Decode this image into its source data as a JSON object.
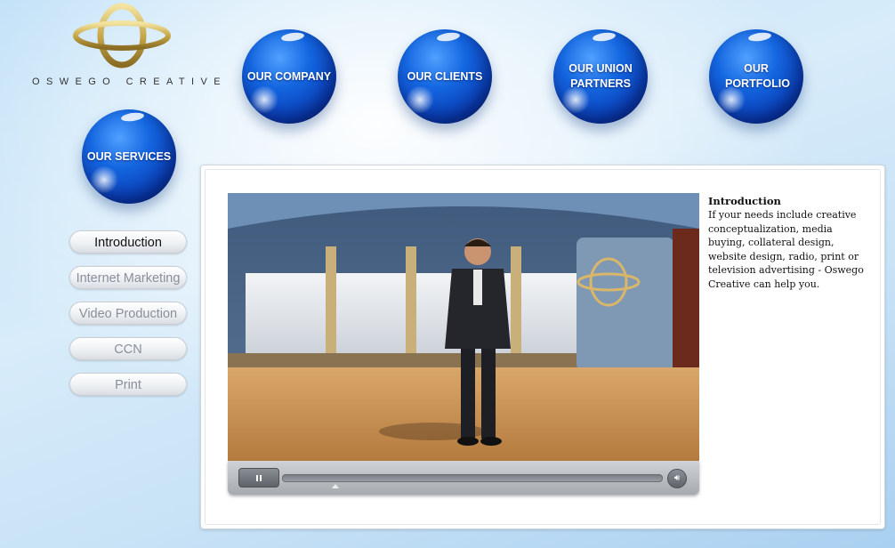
{
  "brand": {
    "name": "OSWEGO CREATIVE",
    "logo_icon": "oc-ring-logo"
  },
  "top_nav": [
    {
      "label": "OUR COMPANY"
    },
    {
      "label": "OUR CLIENTS"
    },
    {
      "label": "OUR UNION PARTNERS"
    },
    {
      "label": "OUR PORTFOLIO"
    }
  ],
  "section_orb": {
    "label": "OUR SERVICES"
  },
  "side_nav": [
    {
      "label": "Introduction",
      "active": true
    },
    {
      "label": "Internet Marketing"
    },
    {
      "label": "Video Production"
    },
    {
      "label": "CCN"
    },
    {
      "label": "Print"
    }
  ],
  "video": {
    "icons": {
      "pause": "pause-icon",
      "volume": "volume-icon"
    },
    "progress": 0.14
  },
  "content": {
    "title": "Introduction",
    "body": "If your needs include creative conceptualization, media buying,  collateral design, website design, radio, print or television advertising - Oswego Creative can help you."
  },
  "colors": {
    "orb_blue": "#1466e0",
    "gold": "#c8a84a"
  }
}
